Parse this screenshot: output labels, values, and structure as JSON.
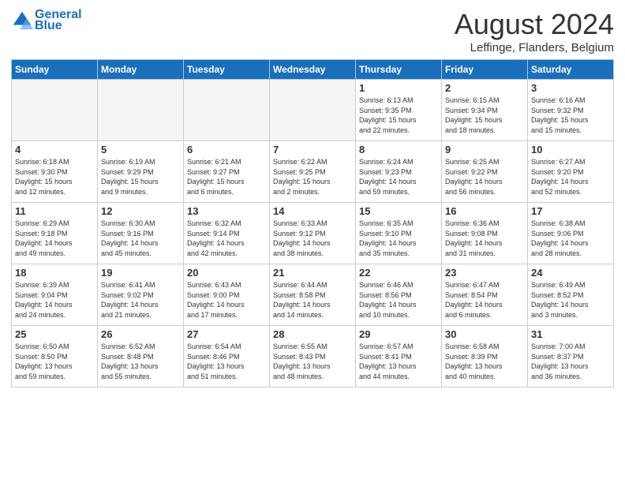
{
  "header": {
    "logo_line1": "General",
    "logo_line2": "Blue",
    "month_year": "August 2024",
    "location": "Leffinge, Flanders, Belgium"
  },
  "weekdays": [
    "Sunday",
    "Monday",
    "Tuesday",
    "Wednesday",
    "Thursday",
    "Friday",
    "Saturday"
  ],
  "weeks": [
    [
      {
        "day": "",
        "info": ""
      },
      {
        "day": "",
        "info": ""
      },
      {
        "day": "",
        "info": ""
      },
      {
        "day": "",
        "info": ""
      },
      {
        "day": "1",
        "info": "Sunrise: 6:13 AM\nSunset: 9:35 PM\nDaylight: 15 hours\nand 22 minutes."
      },
      {
        "day": "2",
        "info": "Sunrise: 6:15 AM\nSunset: 9:34 PM\nDaylight: 15 hours\nand 18 minutes."
      },
      {
        "day": "3",
        "info": "Sunrise: 6:16 AM\nSunset: 9:32 PM\nDaylight: 15 hours\nand 15 minutes."
      }
    ],
    [
      {
        "day": "4",
        "info": "Sunrise: 6:18 AM\nSunset: 9:30 PM\nDaylight: 15 hours\nand 12 minutes."
      },
      {
        "day": "5",
        "info": "Sunrise: 6:19 AM\nSunset: 9:29 PM\nDaylight: 15 hours\nand 9 minutes."
      },
      {
        "day": "6",
        "info": "Sunrise: 6:21 AM\nSunset: 9:27 PM\nDaylight: 15 hours\nand 6 minutes."
      },
      {
        "day": "7",
        "info": "Sunrise: 6:22 AM\nSunset: 9:25 PM\nDaylight: 15 hours\nand 2 minutes."
      },
      {
        "day": "8",
        "info": "Sunrise: 6:24 AM\nSunset: 9:23 PM\nDaylight: 14 hours\nand 59 minutes."
      },
      {
        "day": "9",
        "info": "Sunrise: 6:25 AM\nSunset: 9:22 PM\nDaylight: 14 hours\nand 56 minutes."
      },
      {
        "day": "10",
        "info": "Sunrise: 6:27 AM\nSunset: 9:20 PM\nDaylight: 14 hours\nand 52 minutes."
      }
    ],
    [
      {
        "day": "11",
        "info": "Sunrise: 6:29 AM\nSunset: 9:18 PM\nDaylight: 14 hours\nand 49 minutes."
      },
      {
        "day": "12",
        "info": "Sunrise: 6:30 AM\nSunset: 9:16 PM\nDaylight: 14 hours\nand 45 minutes."
      },
      {
        "day": "13",
        "info": "Sunrise: 6:32 AM\nSunset: 9:14 PM\nDaylight: 14 hours\nand 42 minutes."
      },
      {
        "day": "14",
        "info": "Sunrise: 6:33 AM\nSunset: 9:12 PM\nDaylight: 14 hours\nand 38 minutes."
      },
      {
        "day": "15",
        "info": "Sunrise: 6:35 AM\nSunset: 9:10 PM\nDaylight: 14 hours\nand 35 minutes."
      },
      {
        "day": "16",
        "info": "Sunrise: 6:36 AM\nSunset: 9:08 PM\nDaylight: 14 hours\nand 31 minutes."
      },
      {
        "day": "17",
        "info": "Sunrise: 6:38 AM\nSunset: 9:06 PM\nDaylight: 14 hours\nand 28 minutes."
      }
    ],
    [
      {
        "day": "18",
        "info": "Sunrise: 6:39 AM\nSunset: 9:04 PM\nDaylight: 14 hours\nand 24 minutes."
      },
      {
        "day": "19",
        "info": "Sunrise: 6:41 AM\nSunset: 9:02 PM\nDaylight: 14 hours\nand 21 minutes."
      },
      {
        "day": "20",
        "info": "Sunrise: 6:43 AM\nSunset: 9:00 PM\nDaylight: 14 hours\nand 17 minutes."
      },
      {
        "day": "21",
        "info": "Sunrise: 6:44 AM\nSunset: 8:58 PM\nDaylight: 14 hours\nand 14 minutes."
      },
      {
        "day": "22",
        "info": "Sunrise: 6:46 AM\nSunset: 8:56 PM\nDaylight: 14 hours\nand 10 minutes."
      },
      {
        "day": "23",
        "info": "Sunrise: 6:47 AM\nSunset: 8:54 PM\nDaylight: 14 hours\nand 6 minutes."
      },
      {
        "day": "24",
        "info": "Sunrise: 6:49 AM\nSunset: 8:52 PM\nDaylight: 14 hours\nand 3 minutes."
      }
    ],
    [
      {
        "day": "25",
        "info": "Sunrise: 6:50 AM\nSunset: 8:50 PM\nDaylight: 13 hours\nand 59 minutes."
      },
      {
        "day": "26",
        "info": "Sunrise: 6:52 AM\nSunset: 8:48 PM\nDaylight: 13 hours\nand 55 minutes."
      },
      {
        "day": "27",
        "info": "Sunrise: 6:54 AM\nSunset: 8:46 PM\nDaylight: 13 hours\nand 51 minutes."
      },
      {
        "day": "28",
        "info": "Sunrise: 6:55 AM\nSunset: 8:43 PM\nDaylight: 13 hours\nand 48 minutes."
      },
      {
        "day": "29",
        "info": "Sunrise: 6:57 AM\nSunset: 8:41 PM\nDaylight: 13 hours\nand 44 minutes."
      },
      {
        "day": "30",
        "info": "Sunrise: 6:58 AM\nSunset: 8:39 PM\nDaylight: 13 hours\nand 40 minutes."
      },
      {
        "day": "31",
        "info": "Sunrise: 7:00 AM\nSunset: 8:37 PM\nDaylight: 13 hours\nand 36 minutes."
      }
    ]
  ]
}
